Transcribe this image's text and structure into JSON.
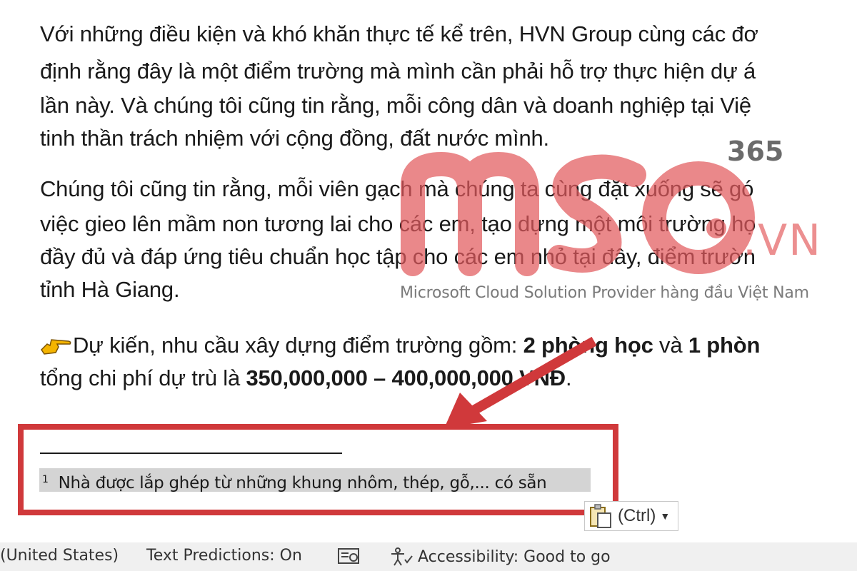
{
  "document": {
    "p1": [
      "Với những điều kiện và khó khăn thực tế kể trên, HVN Group cùng các đơ",
      "định rằng đây là một điểm trường mà mình cần phải hỗ trợ thực hiện dự á",
      "lần này. Và chúng tôi cũng tin rằng, mỗi công dân và doanh nghiệp tại Việ",
      "tinh thần trách nhiệm với cộng đồng, đất nước mình."
    ],
    "p2": [
      "Chúng tôi cũng tin rằng, mỗi viên gạch mà chúng ta cùng đặt xuống sẽ gó",
      "việc gieo lên mầm non tương lai cho các em, tạo dựng một môi trường họ",
      "đầy đủ và đáp ứng tiêu chuẩn học tập cho các em nhỏ tại đây, điểm trườn",
      "tỉnh Hà Giang."
    ],
    "p3": {
      "pre": "Dự kiến, nhu cầu xây dựng điểm trường gồm: ",
      "b1": "2 phòng học",
      "mid": " và ",
      "b2": "1 phòn",
      "line2_pre": "tổng chi phí dự trù là ",
      "line2_bold": "350,000,000 – 400,000,000 VNĐ",
      "line2_post": "."
    },
    "footnote": {
      "number": "1",
      "text": "Nhà được lắp ghép từ những khung nhôm, thép, gỗ,... có sẵn"
    }
  },
  "paste_options": {
    "label": "(Ctrl)"
  },
  "watermark": {
    "logo": "MSO",
    "suffix_365": "365",
    "suffix_vn": ".VN",
    "tagline": "Microsoft Cloud Solution Provider hàng đầu Việt Nam"
  },
  "status_bar": {
    "language": "(United States)",
    "text_predictions": "Text Predictions: On",
    "accessibility": "Accessibility: Good to go"
  },
  "colors": {
    "annotation_red": "#d0393b",
    "footnote_highlight": "#d4d4d4",
    "status_bar_bg": "#f0f0f0"
  },
  "icons": [
    "pointing-hand-icon",
    "paste-clipboard-icon",
    "dropdown-arrow-icon",
    "focus-mode-icon",
    "accessibility-icon"
  ]
}
